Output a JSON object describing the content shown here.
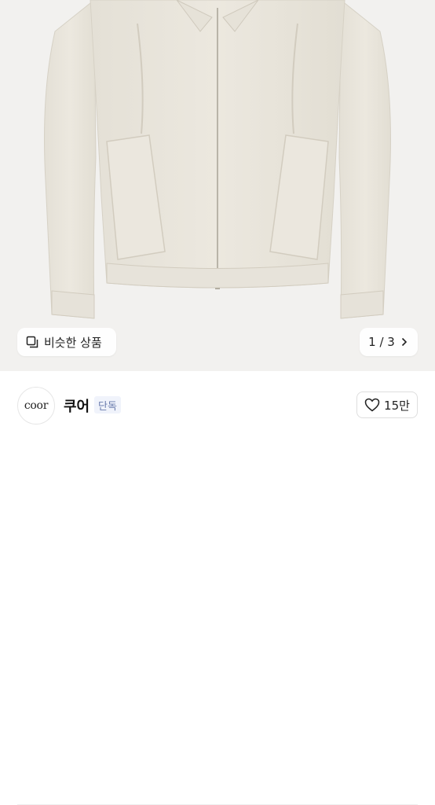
{
  "product_image": {
    "alt_subject": "jacket-photo"
  },
  "similar_button": {
    "label": "비슷한 상품",
    "icon": "similar-items-icon"
  },
  "image_counter": {
    "current": "1",
    "separator": "/",
    "total": "3",
    "text": "1 / 3",
    "icon": "chevron-right-icon"
  },
  "shop": {
    "logo_text": "coor",
    "name": "쿠어",
    "badge": "단독"
  },
  "like": {
    "count": "15만",
    "icon": "heart-outline-icon"
  },
  "colors": {
    "photo_bg": "#f2f1ef",
    "jacket": "#e9e5dc",
    "badge_text": "#6a7cad",
    "badge_bg": "#f0f3fb"
  }
}
